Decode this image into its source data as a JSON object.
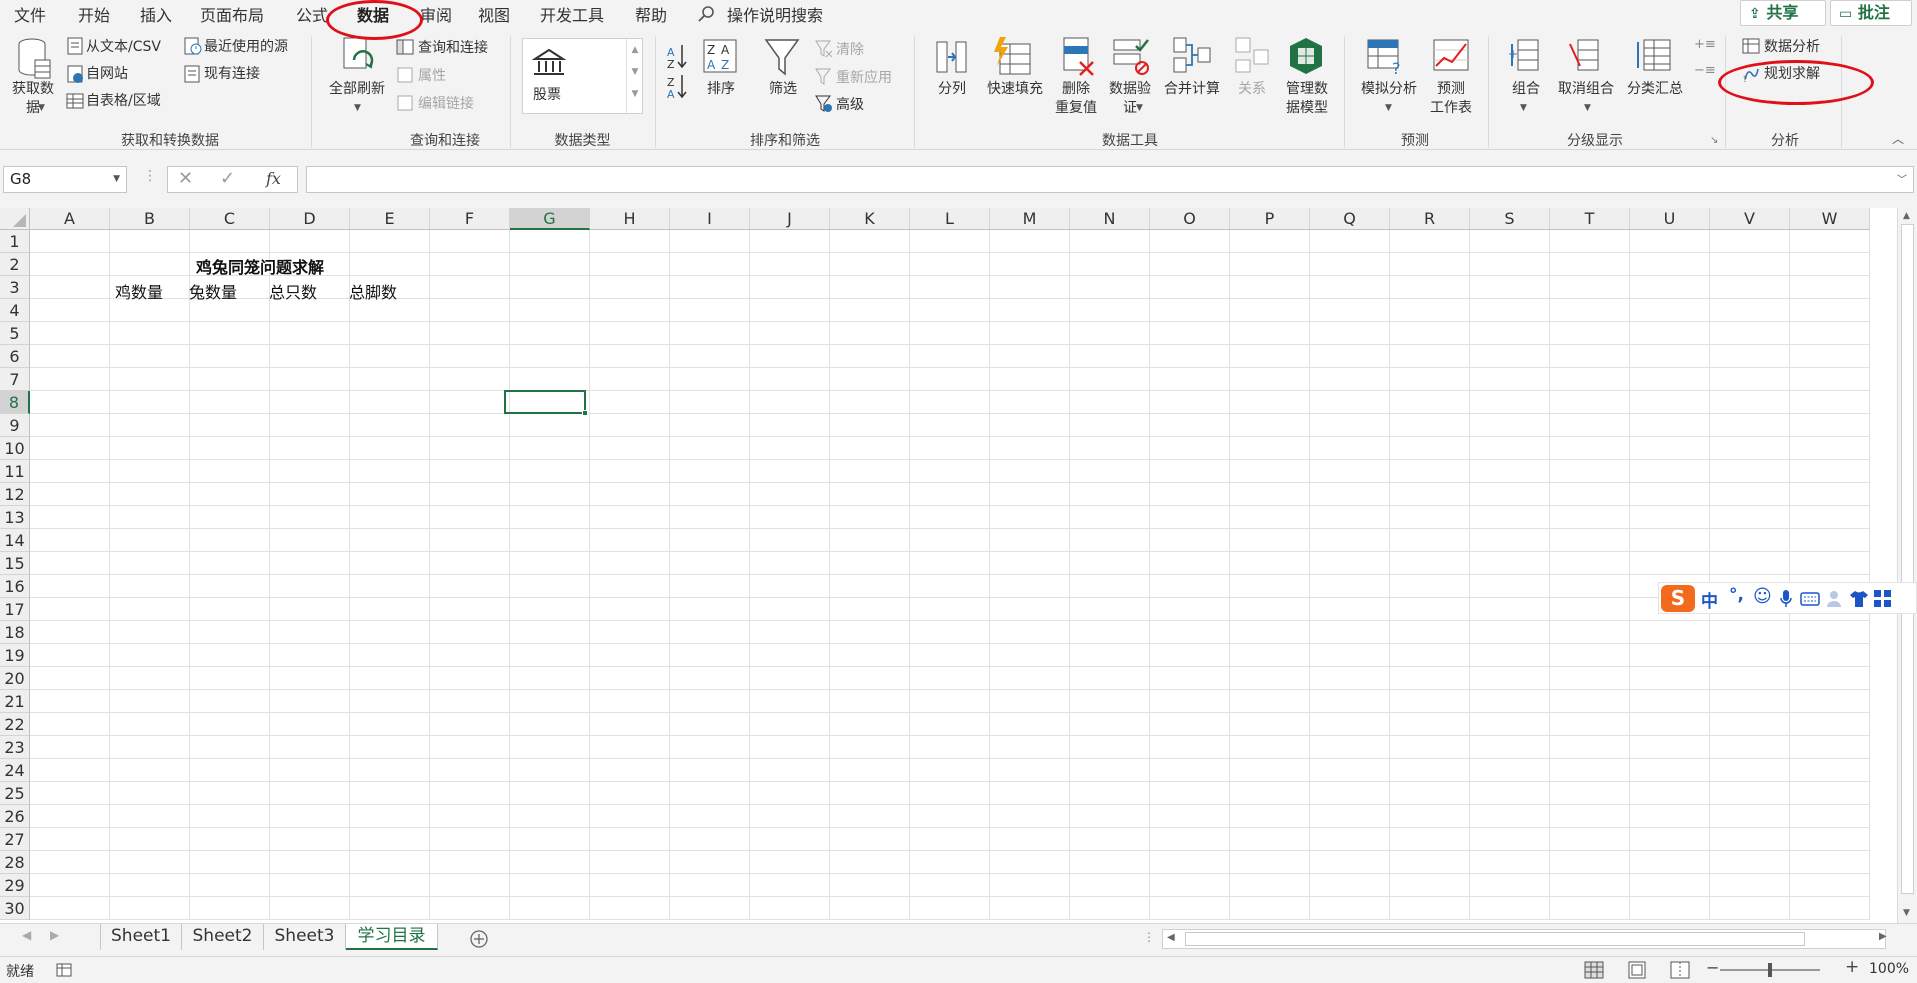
{
  "menu": {
    "tabs": [
      "文件",
      "开始",
      "插入",
      "页面布局",
      "公式",
      "数据",
      "审阅",
      "视图",
      "开发工具",
      "帮助"
    ],
    "search": "操作说明搜索",
    "share": "共享",
    "comment": "批注"
  },
  "ribbon": {
    "get_data": {
      "line1": "获取数",
      "line2": "据"
    },
    "from_csv": "从文本/CSV",
    "from_web": "自网站",
    "from_table": "自表格/区域",
    "recent_sources": "最近使用的源",
    "existing_conn": "现有连接",
    "group_get": "获取和转换数据",
    "refresh_all": "全部刷新",
    "queries_conn": "查询和连接",
    "properties": "属性",
    "edit_links": "编辑链接",
    "group_query": "查询和连接",
    "stocks": "股票",
    "group_datatype": "数据类型",
    "sort": "排序",
    "filter": "筛选",
    "clear": "清除",
    "reapply": "重新应用",
    "advanced": "高级",
    "group_sort": "排序和筛选",
    "text_to_columns": "分列",
    "flash_fill": "快速填充",
    "remove_dup": {
      "line1": "删除",
      "line2": "重复值"
    },
    "data_validation": {
      "line1": "数据验",
      "line2": "证"
    },
    "consolidate": "合并计算",
    "relationships": "关系",
    "manage_model": {
      "line1": "管理数",
      "line2": "据模型"
    },
    "group_tools": "数据工具",
    "what_if": "模拟分析",
    "forecast_sheet": {
      "line1": "预测",
      "line2": "工作表"
    },
    "group_forecast": "预测",
    "group_btn": "组合",
    "ungroup": "取消组合",
    "subtotal": "分类汇总",
    "group_outline": "分级显示",
    "data_analysis": "数据分析",
    "solver": "规划求解",
    "group_analysis": "分析"
  },
  "formula_bar": {
    "name_box": "G8",
    "fx": "fx",
    "formula": ""
  },
  "grid": {
    "columns": [
      "A",
      "B",
      "C",
      "D",
      "E",
      "F",
      "G",
      "H",
      "I",
      "J",
      "K",
      "L",
      "M",
      "N",
      "O",
      "P",
      "Q",
      "R",
      "S",
      "T",
      "U",
      "V",
      "W"
    ],
    "rows": [
      "1",
      "2",
      "3",
      "4",
      "5",
      "6",
      "7",
      "8",
      "9",
      "10",
      "11",
      "12",
      "13",
      "14",
      "15",
      "16",
      "17",
      "18",
      "19",
      "20",
      "21",
      "22",
      "23",
      "24",
      "25",
      "26",
      "27",
      "28",
      "29",
      "30"
    ],
    "selected_col": "G",
    "selected_row": "8",
    "title": "鸡兔同笼问题求解",
    "headers": [
      "鸡数量",
      "兔数量",
      "总只数",
      "总脚数"
    ]
  },
  "sheets": [
    "Sheet1",
    "Sheet2",
    "Sheet3",
    "学习目录"
  ],
  "active_sheet": "学习目录",
  "status": {
    "ready": "就绪",
    "zoom": "100%"
  },
  "ime": {
    "mode": "中"
  },
  "colors": {
    "accent": "#217346",
    "highlight": "#e0101b"
  }
}
